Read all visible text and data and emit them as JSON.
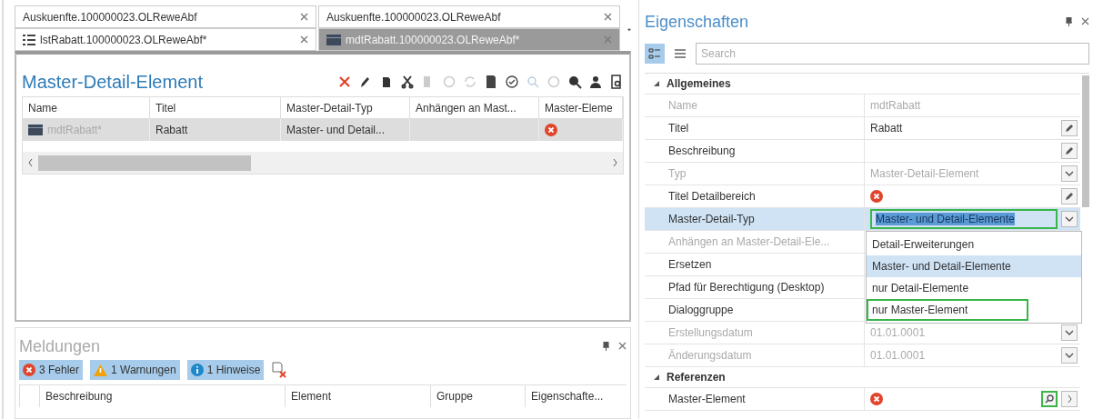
{
  "tab_rows": [
    [
      {
        "label": "Auskuenfte.100000023.OLReweAbf",
        "kind": "plain",
        "selected": false
      },
      {
        "label": "Auskuenfte.100000023.OLReweAbf",
        "kind": "plain",
        "selected": false
      }
    ],
    [
      {
        "label": "lstRabatt.100000023.OLReweAbf*",
        "kind": "list",
        "selected": false
      },
      {
        "label": "mdtRabatt.100000023.OLReweAbf*",
        "kind": "element",
        "selected": true
      }
    ]
  ],
  "document": {
    "title": "Master-Detail-Element",
    "table": {
      "columns": [
        "Name",
        "Titel",
        "Master-Detail-Typ",
        "Anhängen an Mast...",
        "Master-Eleme"
      ],
      "rows": [
        {
          "selected": true,
          "cells": [
            {
              "kind": "element",
              "text": "mdtRabatt*"
            },
            {
              "kind": "text",
              "text": "Rabatt"
            },
            {
              "kind": "text",
              "text": "Master- und Detail..."
            },
            {
              "kind": "empty"
            },
            {
              "kind": "error"
            }
          ]
        }
      ]
    }
  },
  "messages": {
    "title": "Meldungen",
    "filters": [
      {
        "kind": "error",
        "label": "3 Fehler",
        "selected": true
      },
      {
        "kind": "warning",
        "label": "1 Warnungen",
        "selected": true
      },
      {
        "kind": "info",
        "label": "1 Hinweise",
        "selected": true
      }
    ],
    "columns": [
      "Beschreibung",
      "Element",
      "Gruppe",
      "Eigenschafte..."
    ]
  },
  "properties": {
    "title": "Eigenschaften",
    "search": {
      "placeholder": "Search"
    },
    "rows": [
      {
        "kind": "section",
        "label": "Allgemeines"
      },
      {
        "kind": "plain",
        "label": "Name",
        "value": "mdtRabatt",
        "disabled": true,
        "selected": false
      },
      {
        "kind": "edit",
        "label": "Titel",
        "value": "Rabatt",
        "disabled": false,
        "selected": false
      },
      {
        "kind": "edit",
        "label": "Beschreibung",
        "disabled": false,
        "selected": false
      },
      {
        "kind": "dropdown",
        "label": "Typ",
        "value": "Master-Detail-Element",
        "disabled": true,
        "selected": false
      },
      {
        "kind": "edit",
        "label": "Titel Detailbereich",
        "error": true,
        "disabled": false,
        "selected": false
      },
      {
        "kind": "dropdown",
        "label": "Master-Detail-Typ",
        "value": "Master- und Detail-Elemente",
        "disabled": false,
        "selected": true,
        "outlined": true,
        "options": [
          {
            "label": "Detail-Erweiterungen",
            "selected": false,
            "outlined": false
          },
          {
            "label": "Master- und Detail-Elemente",
            "selected": true,
            "outlined": false
          },
          {
            "label": "nur Detail-Elemente",
            "selected": false,
            "outlined": false
          },
          {
            "label": "nur Master-Element",
            "selected": false,
            "outlined": true
          }
        ]
      },
      {
        "kind": "plain",
        "label": "Anhängen an Master-Detail-Ele...",
        "disabled": true,
        "selected": false
      },
      {
        "kind": "plain",
        "label": "Ersetzen",
        "disabled": false,
        "selected": false
      },
      {
        "kind": "plain",
        "label": "Pfad für Berechtigung (Desktop)",
        "disabled": false,
        "selected": false
      },
      {
        "kind": "plain",
        "label": "Dialoggruppe",
        "disabled": false,
        "selected": false
      },
      {
        "kind": "dropdown",
        "label": "Erstellungsdatum",
        "value": "01.01.0001",
        "disabled": true,
        "selected": false
      },
      {
        "kind": "dropdown",
        "label": "Änderungsdatum",
        "value": "01.01.0001",
        "disabled": true,
        "selected": false
      },
      {
        "kind": "section",
        "label": "Referenzen"
      },
      {
        "kind": "lookup",
        "label": "Master-Element",
        "error": true,
        "disabled": false,
        "selected": false
      }
    ]
  }
}
